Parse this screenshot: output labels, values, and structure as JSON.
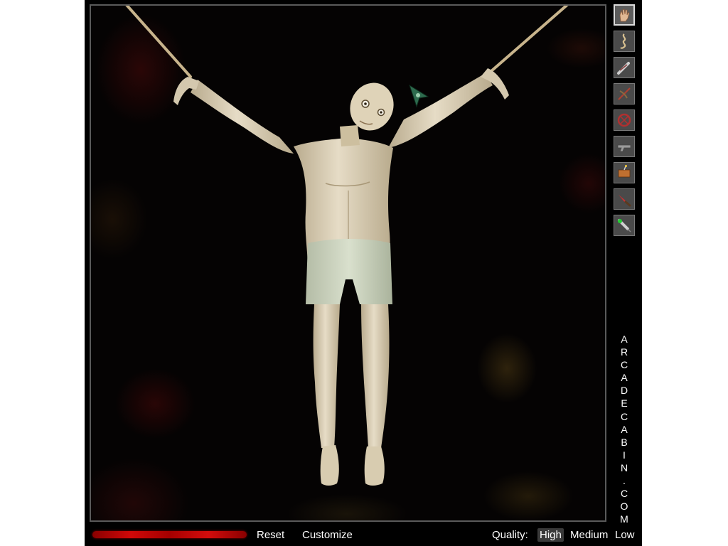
{
  "brand": {
    "text": "ARCADECABIN.COM",
    "letters": [
      "A",
      "R",
      "C",
      "A",
      "D",
      "E",
      "C",
      "A",
      "B",
      "I",
      "N",
      ".",
      "C",
      "O",
      "M"
    ]
  },
  "toolbar": {
    "tools": [
      {
        "name": "hand-tool",
        "icon": "hand-icon",
        "active": true
      },
      {
        "name": "rope-tool",
        "icon": "rope-icon",
        "active": false
      },
      {
        "name": "bat-tool",
        "icon": "bat-icon",
        "active": false
      },
      {
        "name": "crossbow-tool",
        "icon": "crossbow-icon",
        "active": false
      },
      {
        "name": "wheel-tool",
        "icon": "wheel-icon",
        "active": false
      },
      {
        "name": "gun-tool",
        "icon": "gun-icon",
        "active": false
      },
      {
        "name": "explosive-tool",
        "icon": "explosive-icon",
        "active": false
      },
      {
        "name": "knife-tool",
        "icon": "knife-icon",
        "active": false
      },
      {
        "name": "syringe-tool",
        "icon": "syringe-icon",
        "active": false
      }
    ]
  },
  "bottombar": {
    "reset_label": "Reset",
    "customize_label": "Customize",
    "quality_label": "Quality:",
    "quality_options": [
      "High",
      "Medium",
      "Low"
    ],
    "quality_selected": "High",
    "health_level": 1.0
  },
  "colors": {
    "health": "#d10808",
    "skin": "#d8ccb4",
    "shorts": "#c8d0bc",
    "rope": "#c8b48c",
    "cursor": "#2e6b4e"
  }
}
